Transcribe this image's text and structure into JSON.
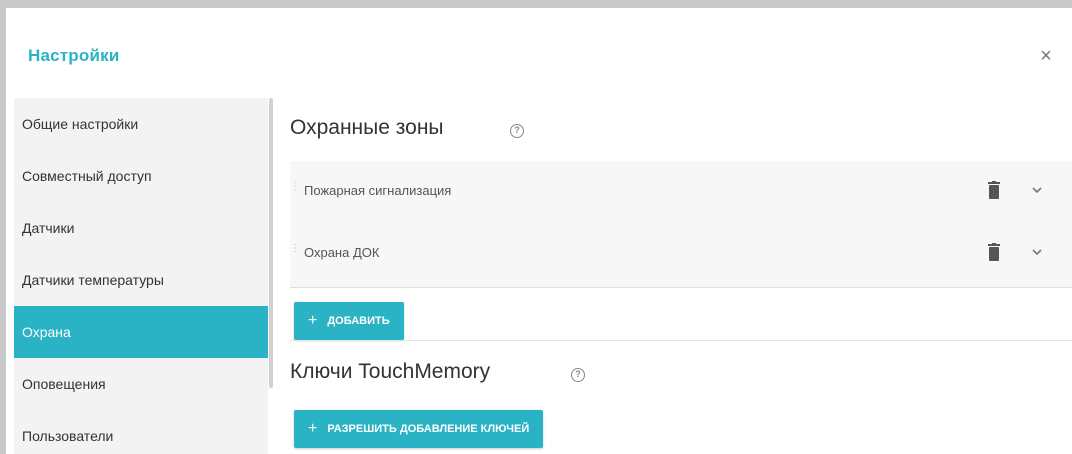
{
  "dialog": {
    "title": "Настройки",
    "close_symbol": "×"
  },
  "sidebar": {
    "items": [
      {
        "label": "Общие настройки",
        "active": false
      },
      {
        "label": "Совместный доступ",
        "active": false
      },
      {
        "label": "Датчики",
        "active": false
      },
      {
        "label": "Датчики температуры",
        "active": false
      },
      {
        "label": "Охрана",
        "active": true
      },
      {
        "label": "Оповещения",
        "active": false
      },
      {
        "label": "Пользователи",
        "active": false
      }
    ]
  },
  "main": {
    "zones_section": {
      "title": "Охранные зоны",
      "help_symbol": "?",
      "zones": [
        {
          "name": "Пожарная сигнализация"
        },
        {
          "name": "Охрана ДОК"
        }
      ],
      "add_button": {
        "plus": "+",
        "label": "ДОБАВИТЬ"
      }
    },
    "keys_section": {
      "title": "Ключи TouchMemory",
      "help_symbol": "?",
      "allow_button": {
        "plus": "+",
        "label": "РАЗРЕШИТЬ ДОБАВЛЕНИЕ КЛЮЧЕЙ"
      }
    }
  },
  "colors": {
    "accent": "#29b3c4",
    "sidebar_bg": "#f3f3f3",
    "text": "#333333"
  },
  "icons": [
    "close-icon",
    "help-icon",
    "drag-handle-icon",
    "trash-icon",
    "chevron-down-icon",
    "plus-icon"
  ]
}
